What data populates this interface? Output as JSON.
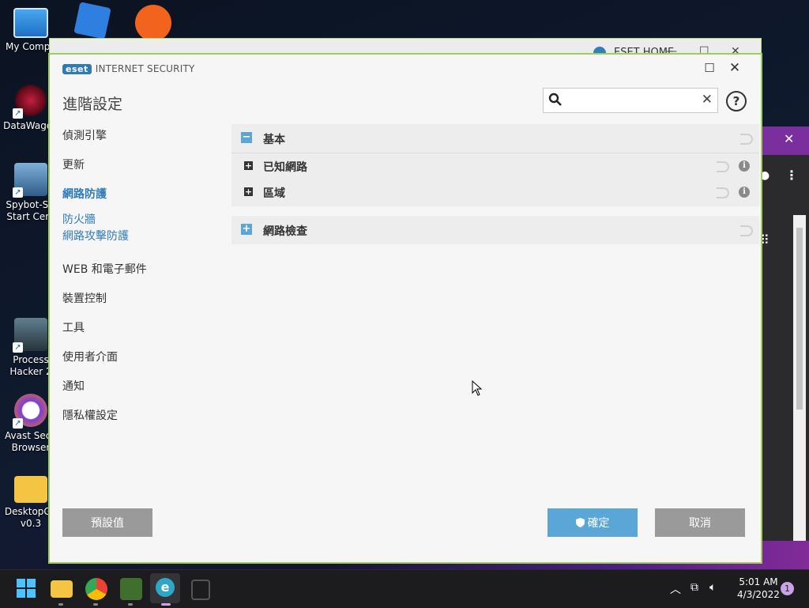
{
  "desktop": {
    "icons": [
      {
        "label": "My Compu",
        "name": "my-computer"
      },
      {
        "label": "DataWagon",
        "name": "datawagon"
      },
      {
        "label": "Spybot-S&",
        "label2": "Start Cent",
        "name": "spybot"
      },
      {
        "label": "Process",
        "label2": "Hacker 2",
        "name": "process-hacker"
      },
      {
        "label": "Avast Secu",
        "label2": "Browser",
        "name": "avast-browser"
      },
      {
        "label": "DesktopGo",
        "label2": "v0.3",
        "name": "desktopgo"
      }
    ]
  },
  "background_window": {
    "title": "ESET HOME"
  },
  "dialog": {
    "brand": "eset",
    "product": "INTERNET SECURITY",
    "title": "進階設定",
    "search": {
      "value": "",
      "placeholder": ""
    },
    "help": "?",
    "nav": [
      {
        "label": "偵測引擎"
      },
      {
        "label": "更新"
      },
      {
        "label": "網路防護"
      },
      {
        "label": "防火牆"
      },
      {
        "label": "網路攻擊防護"
      },
      {
        "label": "WEB 和電子郵件"
      },
      {
        "label": "裝置控制"
      },
      {
        "label": "工具"
      },
      {
        "label": "使用者介面"
      },
      {
        "label": "通知"
      },
      {
        "label": "隱私權設定"
      }
    ],
    "sections": [
      {
        "title": "基本",
        "toggle": "−",
        "rows": [
          {
            "title": "已知網路",
            "toggle": "+"
          },
          {
            "title": "區域",
            "toggle": "+"
          }
        ]
      },
      {
        "title": "網路檢查",
        "toggle": "+"
      }
    ],
    "buttons": {
      "default": "預設值",
      "ok": "確定",
      "cancel": "取消"
    }
  },
  "taskbar": {
    "time": "5:01 AM",
    "date": "4/3/2022",
    "notifications": "1"
  },
  "colors": {
    "accent": "#2f7bb8",
    "button_blue": "#5aa6d6",
    "button_gray": "#9a9a9a",
    "border_green": "#9fcf5a"
  }
}
